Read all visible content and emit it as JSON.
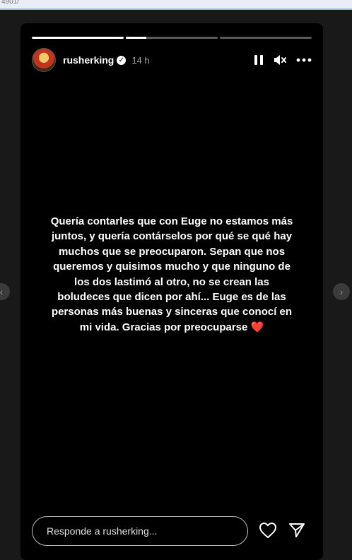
{
  "browser": {
    "url_fragment": "4901/"
  },
  "story": {
    "progress": [
      1.0,
      0.22,
      0.0
    ],
    "username": "rusherking",
    "time": "14 h",
    "message": "Quería contarles que con Euge no estamos más juntos, y quería contárselos por qué se qué hay muchos que se preocuparon. Sepan que nos queremos y quisimos mucho y que ninguno de los dos lastimó al otro, no se crean las boludeces que dicen por ahí... Euge es de las personas más buenas y sinceras que conocí en mi vida. Gracias por preocuparse",
    "heart": "❤️",
    "reply_placeholder": "Responde a rusherking...",
    "icons": [
      "verified-badge-icon",
      "pause-icon",
      "mute-icon",
      "more-icon",
      "heart-icon",
      "send-icon",
      "chevron-left-icon",
      "chevron-right-icon"
    ]
  }
}
